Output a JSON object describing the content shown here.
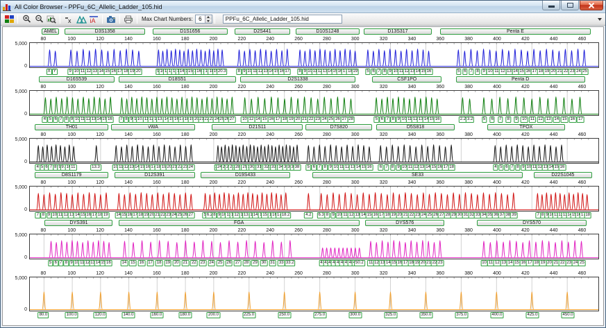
{
  "window": {
    "title": "All Color Browser - PPFu_6C_Allelic_Ladder_105.hid"
  },
  "toolbar": {
    "icons": [
      "color-channels-icon",
      "zoom-in-icon",
      "zoom-out-icon",
      "zoom-region-icon",
      "hide-labels-icon",
      "overlay-markers-icon",
      "overlay-traces-icon",
      "snapshot-icon",
      "print-icon"
    ],
    "max_chart_numbers_label": "Max Chart Numbers:",
    "max_chart_numbers_value": "6",
    "file_field_value": "PPFu_6C_Allelic_Ladder_105.hid"
  },
  "x_axis": {
    "ticks": [
      80,
      100,
      120,
      140,
      160,
      180,
      200,
      220,
      240,
      260,
      280,
      300,
      320,
      340,
      360,
      380,
      400,
      420,
      440,
      460
    ],
    "gridlines": [
      80,
      100,
      120,
      140,
      160,
      180,
      200,
      225,
      250,
      275,
      300,
      325,
      350,
      375,
      400,
      425,
      450
    ]
  },
  "y_axis": {
    "max_label": "5,000",
    "min_label": "0"
  },
  "marker_box_border_color": "#2f9e3f",
  "channels": [
    {
      "name": "blue",
      "color": "#1c1cd8",
      "headers": [
        {
          "label": "AMEL",
          "start": 79,
          "end": 91
        },
        {
          "label": "D3S1358",
          "start": 95,
          "end": 152
        },
        {
          "label": "D1S1656",
          "start": 157,
          "end": 210
        },
        {
          "label": "D2S441",
          "start": 215,
          "end": 254
        },
        {
          "label": "D10S1248",
          "start": 258,
          "end": 303
        },
        {
          "label": "D13S317",
          "start": 306,
          "end": 354
        },
        {
          "label": "Penta E",
          "start": 360,
          "end": 466
        }
      ],
      "groups": [
        {
          "alleles": [
            "X",
            "Y"
          ],
          "start": 84,
          "end": 88
        },
        {
          "alleles": [
            "9",
            "10",
            "11",
            "12",
            "13",
            "14",
            "15",
            "16",
            "17",
            "18",
            "19",
            "20"
          ],
          "start": 99,
          "end": 147
        },
        {
          "alleles": [
            "9",
            "10",
            "11",
            "12",
            "13",
            "14",
            "14.3",
            "15",
            "15.3",
            "16",
            "16.3",
            "17",
            "17.3",
            "18.3",
            "19.3",
            "20.3"
          ],
          "start": 161,
          "end": 206
        },
        {
          "alleles": [
            "8",
            "9",
            "10",
            "11",
            "12",
            "13",
            "14",
            "15",
            "16",
            "17"
          ],
          "start": 218,
          "end": 252
        },
        {
          "alleles": [
            "8",
            "9",
            "10",
            "11",
            "12",
            "13",
            "14",
            "15",
            "16",
            "17",
            "18",
            "19"
          ],
          "start": 261,
          "end": 300
        },
        {
          "alleles": [
            "5",
            "6",
            "7",
            "8",
            "9",
            "10",
            "11",
            "12",
            "13",
            "14",
            "15",
            "16"
          ],
          "start": 309,
          "end": 352
        },
        {
          "alleles": [
            "5",
            "6",
            "7",
            "8",
            "9",
            "10",
            "11",
            "12",
            "13",
            "14",
            "15",
            "16",
            "17",
            "18",
            "19",
            "20",
            "21",
            "22",
            "23",
            "24",
            "25"
          ],
          "start": 373,
          "end": 462
        }
      ]
    },
    {
      "name": "green",
      "color": "#0b7d0b",
      "headers": [
        {
          "label": "D16S539",
          "start": 77,
          "end": 130
        },
        {
          "label": "D18S51",
          "start": 133,
          "end": 216
        },
        {
          "label": "D2S1338",
          "start": 219,
          "end": 300
        },
        {
          "label": "CSF1PO",
          "start": 312,
          "end": 361
        },
        {
          "label": "Penta D",
          "start": 371,
          "end": 462
        }
      ],
      "groups": [
        {
          "alleles": [
            "4",
            "5",
            "6",
            "7",
            "8",
            "9",
            "10",
            "11",
            "12",
            "13",
            "14",
            "15",
            "16"
          ],
          "start": 81,
          "end": 127
        },
        {
          "alleles": [
            "7",
            "8",
            "9",
            "10",
            "10.2",
            "11",
            "12",
            "13",
            "13.2",
            "14",
            "15",
            "16",
            "17",
            "18",
            "19",
            "20",
            "21",
            "22",
            "23",
            "24",
            "25",
            "26",
            "27"
          ],
          "start": 135,
          "end": 213
        },
        {
          "alleles": [
            "10",
            "12",
            "14",
            "15",
            "16",
            "17",
            "18",
            "19",
            "20",
            "21",
            "22",
            "23",
            "24",
            "25",
            "26",
            "27",
            "28"
          ],
          "start": 222,
          "end": 297
        },
        {
          "alleles": [
            "5",
            "6",
            "7",
            "8",
            "9",
            "10",
            "11",
            "12",
            "13",
            "14",
            "15",
            "16"
          ],
          "start": 315,
          "end": 358
        },
        {
          "alleles": [
            "2.2",
            "3.2"
          ],
          "start": 376,
          "end": 381
        },
        {
          "alleles": [
            "5",
            "6",
            "7",
            "8",
            "9",
            "10",
            "11",
            "12",
            "13",
            "14",
            "15",
            "16",
            "17"
          ],
          "start": 391,
          "end": 459
        }
      ]
    },
    {
      "name": "black",
      "color": "#151515",
      "headers": [
        {
          "label": "TH01",
          "start": 74,
          "end": 126
        },
        {
          "label": "vWA",
          "start": 128,
          "end": 187
        },
        {
          "label": "D21S11",
          "start": 199,
          "end": 263
        },
        {
          "label": "D7S820",
          "start": 265,
          "end": 312
        },
        {
          "label": "D5S818",
          "start": 315,
          "end": 370
        },
        {
          "label": "TPOX",
          "start": 393,
          "end": 448
        }
      ],
      "groups": [
        {
          "alleles": [
            "4",
            "5",
            "6",
            "7",
            "8",
            "9",
            "9.3",
            "10",
            "11"
          ],
          "start": 76,
          "end": 101
        },
        {
          "alleles": [
            "13.3"
          ],
          "start": 117,
          "end": 117
        },
        {
          "alleles": [
            "10",
            "11",
            "12",
            "13",
            "14",
            "15",
            "16",
            "17",
            "18",
            "19",
            "20",
            "21",
            "22",
            "23",
            "24"
          ],
          "start": 131,
          "end": 184
        },
        {
          "alleles": [
            "24",
            "24.2",
            "25",
            "26",
            "27",
            "28",
            "28.2",
            "29",
            "29.2",
            "30",
            "30.2",
            "31",
            "31.2",
            "32",
            "32.2",
            "33",
            "33.2",
            "34",
            "34.2",
            "35",
            "36",
            "37",
            "38"
          ],
          "start": 203,
          "end": 259
        },
        {
          "alleles": [
            "5",
            "6",
            "7",
            "8",
            "9",
            "10",
            "11",
            "12",
            "13",
            "14",
            "15",
            "16"
          ],
          "start": 267,
          "end": 310
        },
        {
          "alleles": [
            "6",
            "7",
            "8",
            "9",
            "10",
            "11",
            "12",
            "13",
            "14",
            "15",
            "16",
            "17",
            "18"
          ],
          "start": 318,
          "end": 368
        },
        {
          "alleles": [
            "4",
            "5",
            "6",
            "7",
            "8",
            "9",
            "10",
            "11",
            "12",
            "13",
            "14",
            "15",
            "16"
          ],
          "start": 399,
          "end": 446
        }
      ]
    },
    {
      "name": "red",
      "color": "#d01010",
      "headers": [
        {
          "label": "D8S1179",
          "start": 74,
          "end": 126
        },
        {
          "label": "D12S391",
          "start": 130,
          "end": 187
        },
        {
          "label": "D19S433",
          "start": 191,
          "end": 254
        },
        {
          "label": "SE33",
          "start": 270,
          "end": 418
        },
        {
          "label": "D22S1045",
          "start": 426,
          "end": 467
        }
      ],
      "groups": [
        {
          "alleles": [
            "7",
            "8",
            "9",
            "10",
            "11",
            "12",
            "13",
            "14",
            "15",
            "16",
            "17",
            "18",
            "19"
          ],
          "start": 76,
          "end": 124
        },
        {
          "alleles": [
            "14",
            "15",
            "16",
            "17",
            "18",
            "19",
            "20",
            "21",
            "22",
            "23",
            "24",
            "25",
            "26",
            "27"
          ],
          "start": 133,
          "end": 184
        },
        {
          "alleles": [
            "5",
            "6.2",
            "8",
            "9",
            "10",
            "11",
            "12",
            "12.2",
            "13",
            "13.2",
            "14",
            "14.2",
            "15",
            "15.2",
            "16",
            "16.2",
            "17.2",
            "18.2"
          ],
          "start": 194,
          "end": 251
        },
        {
          "alleles": [
            "4.2"
          ],
          "start": 267,
          "end": 267
        },
        {
          "alleles": [
            "6.3",
            "8",
            "9",
            "10",
            "11",
            "12",
            "13",
            "14",
            "15",
            "16",
            "17",
            "18",
            "19",
            "20",
            "21",
            "22",
            "23",
            "24",
            "25",
            "26",
            "27",
            "28",
            "29",
            "30",
            "31",
            "32",
            "33",
            "34",
            "35",
            "36",
            "37",
            "38",
            "39"
          ],
          "start": 276,
          "end": 412
        },
        {
          "alleles": [
            "7",
            "8",
            "9",
            "10",
            "11",
            "12",
            "13",
            "14",
            "15",
            "16",
            "17",
            "18"
          ],
          "start": 429,
          "end": 464
        }
      ]
    },
    {
      "name": "magenta",
      "color": "#e020c0",
      "headers": [
        {
          "label": "DYS391",
          "start": 81,
          "end": 129
        },
        {
          "label": "FGA",
          "start": 133,
          "end": 303
        },
        {
          "label": "DYS576",
          "start": 307,
          "end": 363
        },
        {
          "label": "DYS570",
          "start": 386,
          "end": 463
        }
      ],
      "groups": [
        {
          "alleles": [
            "5",
            "6",
            "7",
            "8",
            "9",
            "10",
            "11",
            "12",
            "13",
            "14",
            "15",
            "16"
          ],
          "start": 85,
          "end": 126
        },
        {
          "alleles": [
            "14",
            "15",
            "16",
            "17",
            "18",
            "19",
            "20",
            "21",
            "22",
            "23",
            "24",
            "25",
            "26",
            "27",
            "28",
            "29",
            "30",
            "31",
            "33",
            "33.2"
          ],
          "start": 137,
          "end": 254
        },
        {
          "alleles": [
            "41",
            "42",
            "43",
            "44",
            "45",
            "46",
            "47",
            "48",
            "49",
            "50.2"
          ],
          "start": 277,
          "end": 303,
          "h": 0.5
        },
        {
          "alleles": [
            "11",
            "12",
            "13",
            "14",
            "15",
            "16",
            "17",
            "18",
            "19",
            "20",
            "21",
            "22",
            "23"
          ],
          "start": 311,
          "end": 360
        },
        {
          "alleles": [
            "10",
            "11",
            "12",
            "13",
            "14",
            "15",
            "16",
            "17",
            "18",
            "19",
            "20",
            "21",
            "22",
            "23",
            "24",
            "25"
          ],
          "start": 391,
          "end": 460
        }
      ]
    },
    {
      "name": "orange",
      "color": "#f0a030",
      "headers": [],
      "groups": [
        {
          "alleles": [
            "80.0",
            "100.0",
            "120.0",
            "140.0",
            "160.0",
            "180.0",
            "200.0",
            "225.0",
            "250.0",
            "275.0",
            "300.0",
            "325.0",
            "350.0",
            "375.0",
            "400.0",
            "425.0",
            "450.0"
          ],
          "positions": [
            80,
            100,
            120,
            140,
            160,
            180,
            200,
            225,
            250,
            275,
            300,
            325,
            350,
            375,
            400,
            425,
            450
          ],
          "start": 80,
          "end": 450,
          "h": 0.62
        }
      ]
    }
  ]
}
